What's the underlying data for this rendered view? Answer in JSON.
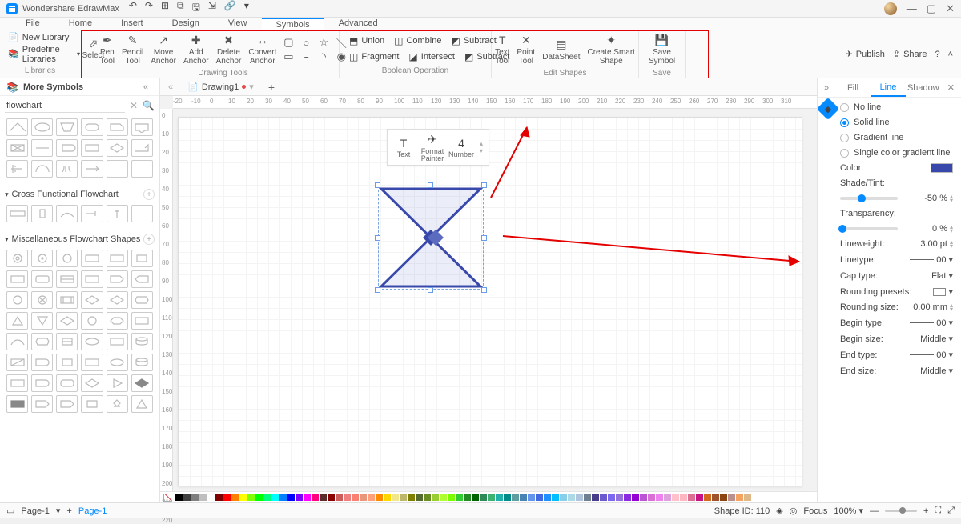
{
  "app_name": "Wondershare EdrawMax",
  "menu": {
    "file": "File",
    "home": "Home",
    "insert": "Insert",
    "design": "Design",
    "view": "View",
    "symbols": "Symbols",
    "advanced": "Advanced"
  },
  "ribbon_left": {
    "new_library": "New Library",
    "predefine": "Predefine Libraries",
    "libraries": "Libraries"
  },
  "ribbon": {
    "select": "Select",
    "pen": "Pen\nTool",
    "pencil": "Pencil\nTool",
    "move": "Move\nAnchor",
    "add": "Add\nAnchor",
    "delete": "Delete\nAnchor",
    "convert": "Convert\nAnchor",
    "group_draw": "Drawing Tools",
    "union": "Union",
    "combine": "Combine",
    "subtract": "Subtract",
    "fragment": "Fragment",
    "intersect": "Intersect",
    "subtract2": "Subtract",
    "group_bool": "Boolean Operation",
    "text": "Text\nTool",
    "point": "Point\nTool",
    "datasheet": "DataSheet",
    "smartshape": "Create Smart\nShape",
    "group_edit": "Edit Shapes",
    "savesym": "Save\nSymbol",
    "group_save": "Save"
  },
  "top_right": {
    "publish": "Publish",
    "share": "Share"
  },
  "side": {
    "more": "More Symbols",
    "search_ph": "flowchart",
    "cross": "Cross Functional Flowchart",
    "misc": "Miscellaneous Flowchart Shapes"
  },
  "canvas": {
    "drawing": "Drawing1",
    "float": {
      "text": "Text",
      "format": "Format\nPainter",
      "number": "Number",
      "numval": "4"
    }
  },
  "panel": {
    "tab_fill": "Fill",
    "tab_line": "Line",
    "tab_shadow": "Shadow",
    "noline": "No line",
    "solid": "Solid line",
    "gradient": "Gradient line",
    "single": "Single color gradient line",
    "color": "Color:",
    "shade": "Shade/Tint:",
    "shade_v": "-50 %",
    "trans": "Transparency:",
    "trans_v": "0 %",
    "lw": "Lineweight:",
    "lw_v": "3.00 pt",
    "lt": "Linetype:",
    "lt_v": "00",
    "cap": "Cap type:",
    "cap_v": "Flat",
    "rp": "Rounding presets:",
    "rs": "Rounding size:",
    "rs_v": "0.00 mm",
    "bt": "Begin type:",
    "bt_v": "00",
    "bs": "Begin size:",
    "bs_v": "Middle",
    "et": "End type:",
    "et_v": "00",
    "es": "End size:",
    "es_v": "Middle"
  },
  "status": {
    "page1": "Page-1",
    "page1b": "Page-1",
    "shapeid": "Shape ID: 110",
    "focus": "Focus",
    "zoom": "100%"
  },
  "ruler_h": [
    -20,
    -10,
    0,
    10,
    20,
    30,
    40,
    50,
    60,
    70,
    80,
    90,
    100,
    110,
    120,
    130,
    140,
    150,
    160,
    170,
    180,
    190,
    200,
    210,
    220,
    230,
    240,
    250,
    260,
    270,
    280,
    290,
    300,
    310
  ],
  "ruler_v": [
    0,
    10,
    20,
    30,
    40,
    50,
    60,
    70,
    80,
    90,
    100,
    110,
    120,
    130,
    140,
    150,
    160,
    170,
    180,
    190,
    200,
    210,
    220
  ],
  "colors": [
    "#000000",
    "#3f3f3f",
    "#7f7f7f",
    "#bfbfbf",
    "#ffffff",
    "#7f0000",
    "#ff0000",
    "#ff7f00",
    "#ffff00",
    "#7fff00",
    "#00ff00",
    "#00ff7f",
    "#00ffff",
    "#007fff",
    "#0000ff",
    "#7f00ff",
    "#ff00ff",
    "#ff007f",
    "#5b2c2c",
    "#8b0000",
    "#cd5c5c",
    "#f08080",
    "#fa8072",
    "#e9967a",
    "#ffa07a",
    "#ff8c00",
    "#ffd700",
    "#f0e68c",
    "#bdb76b",
    "#808000",
    "#556b2f",
    "#6b8e23",
    "#9acd32",
    "#adff2f",
    "#7cfc00",
    "#32cd32",
    "#228b22",
    "#006400",
    "#2e8b57",
    "#3cb371",
    "#20b2aa",
    "#008b8b",
    "#5f9ea0",
    "#4682b4",
    "#6495ed",
    "#4169e1",
    "#1e90ff",
    "#00bfff",
    "#87ceeb",
    "#add8e6",
    "#b0c4de",
    "#708090",
    "#483d8b",
    "#6a5acd",
    "#7b68ee",
    "#9370db",
    "#8a2be2",
    "#9400d3",
    "#ba55d3",
    "#da70d6",
    "#ee82ee",
    "#dda0dd",
    "#ffc0cb",
    "#ffb6c1",
    "#db7093",
    "#c71585",
    "#d2691e",
    "#a0522d",
    "#8b4513",
    "#bc8f8f",
    "#f4a460",
    "#deb887"
  ]
}
